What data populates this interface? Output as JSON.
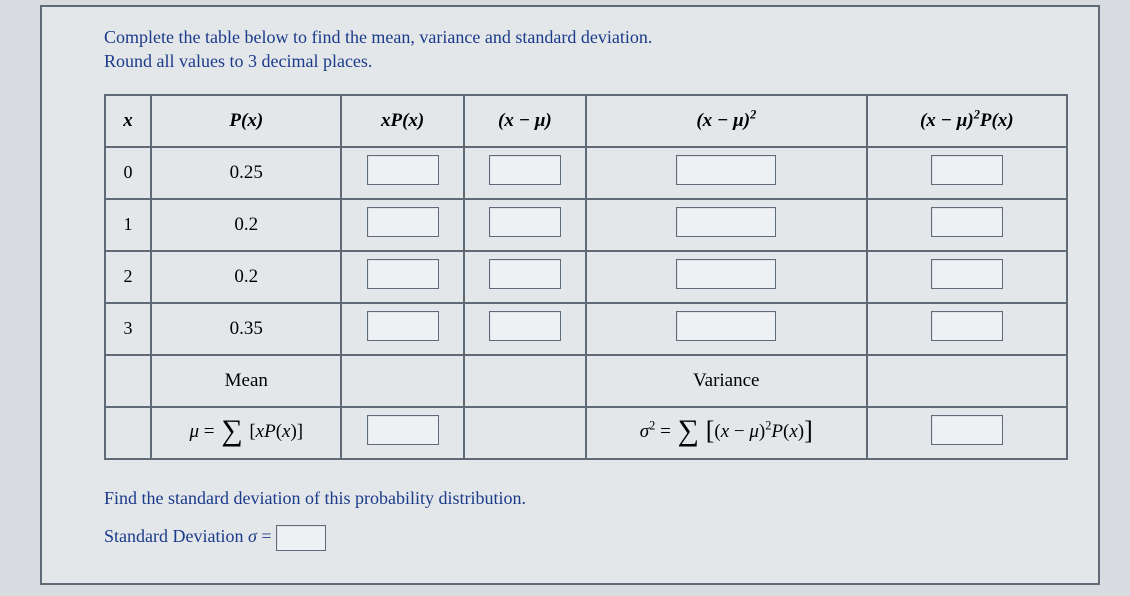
{
  "instructions": {
    "line1": "Complete the table below to find the mean, variance and standard deviation.",
    "line2": "Round all values to 3 decimal places."
  },
  "headers": {
    "x": "x",
    "px": "P(x)",
    "xpx": "xP(x)",
    "xmu": "(x − μ)",
    "xmu2": "(x − μ)²",
    "xmu2px": "(x − μ)²P(x)"
  },
  "rows": [
    {
      "x": "0",
      "px": "0.25"
    },
    {
      "x": "1",
      "px": "0.2"
    },
    {
      "x": "2",
      "px": "0.2"
    },
    {
      "x": "3",
      "px": "0.35"
    }
  ],
  "labels": {
    "mean": "Mean",
    "variance": "Variance"
  },
  "formulas": {
    "mu": "μ = Σ [xP(x)]",
    "sigma2": "σ² = Σ [(x − μ)²P(x)]"
  },
  "below": {
    "prompt": "Find the standard deviation of this probability distribution.",
    "sd_label": "Standard Deviation σ ="
  },
  "chart_data": {
    "type": "table",
    "title": "Probability distribution table for mean, variance and standard deviation",
    "columns": [
      "x",
      "P(x)",
      "xP(x)",
      "(x − μ)",
      "(x − μ)²",
      "(x − μ)²P(x)"
    ],
    "rows": [
      {
        "x": 0,
        "P(x)": 0.25
      },
      {
        "x": 1,
        "P(x)": 0.2
      },
      {
        "x": 2,
        "P(x)": 0.2
      },
      {
        "x": 3,
        "P(x)": 0.35
      }
    ]
  }
}
